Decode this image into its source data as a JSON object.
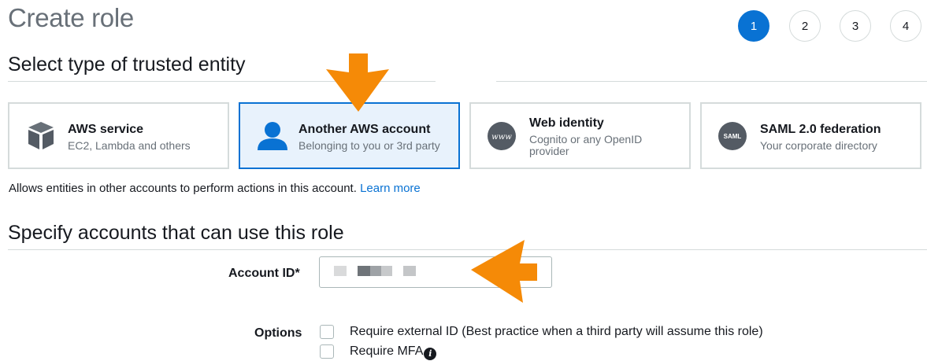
{
  "page": {
    "title": "Create role"
  },
  "steps": [
    {
      "label": "1",
      "active": true
    },
    {
      "label": "2",
      "active": false
    },
    {
      "label": "3",
      "active": false
    },
    {
      "label": "4",
      "active": false
    }
  ],
  "trusted_entity": {
    "heading": "Select type of trusted entity",
    "cards": [
      {
        "title": "AWS service",
        "subtitle": "EC2, Lambda and others",
        "icon": "cube-icon",
        "selected": false
      },
      {
        "title": "Another AWS account",
        "subtitle": "Belonging to you or 3rd party",
        "icon": "user-icon",
        "selected": true
      },
      {
        "title": "Web identity",
        "subtitle": "Cognito or any OpenID provider",
        "icon": "www-icon",
        "icon_text": "www",
        "selected": false
      },
      {
        "title": "SAML 2.0 federation",
        "subtitle": "Your corporate directory",
        "icon": "saml-icon",
        "icon_text": "SAML",
        "selected": false
      }
    ],
    "help_text": "Allows entities in other accounts to perform actions in this account.",
    "learn_more": "Learn more"
  },
  "accounts": {
    "heading": "Specify accounts that can use this role",
    "account_id_label": "Account ID*",
    "account_id_value": "",
    "options_label": "Options",
    "options": [
      {
        "label": "Require external ID (Best practice when a third party will assume this role)",
        "checked": false
      },
      {
        "label": "Require MFA",
        "checked": false
      }
    ]
  },
  "colors": {
    "accent": "#0972d3",
    "annotation_arrow": "#f58a07",
    "selected_card_bg": "#e8f2fc"
  }
}
